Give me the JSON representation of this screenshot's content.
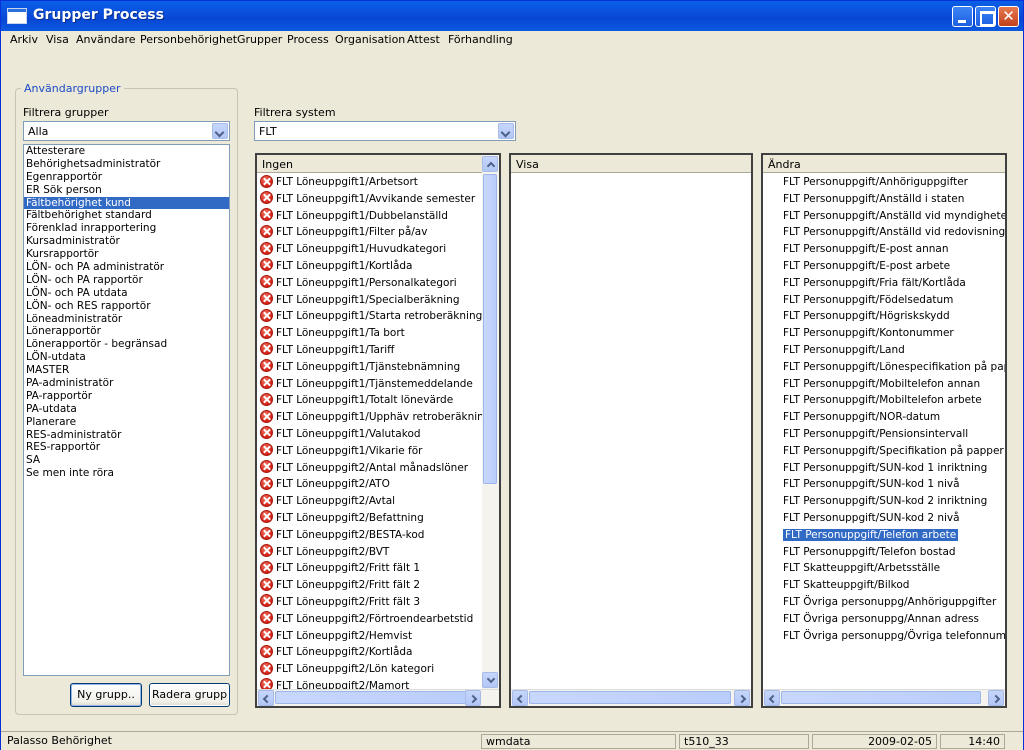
{
  "window": {
    "title": "Grupper Process"
  },
  "menu": [
    "Arkiv",
    "Visa",
    "Användare",
    "Personbehörighet",
    "Grupper",
    "Process",
    "Organisation",
    "Attest",
    "Förhandling"
  ],
  "groups_panel": {
    "title": "Användargrupper",
    "filter_label": "Filtrera grupper",
    "filter_value": "Alla",
    "items": [
      "Attesterare",
      "Behörighetsadministratör",
      "Egenrapportör",
      "ER Sök person",
      "Fältbehörighet kund",
      "Fältbehörighet standard",
      "Förenklad inrapportering",
      "Kursadministratör",
      "Kursrapportör",
      "LÖN- och PA administratör",
      "LÖN- och PA rapportör",
      "LÖN- och PA utdata",
      "LÖN- och RES rapportör",
      "Löneadministratör",
      "Lönerapportör",
      "Lönerapportör - begränsad",
      "LÖN-utdata",
      "MASTER",
      "PA-administratör",
      "PA-rapportör",
      "PA-utdata",
      "Planerare",
      "RES-administratör",
      "RES-rapportör",
      "SA",
      "Se men inte röra"
    ],
    "selected_index": 4,
    "new_button": "Ny grupp..",
    "delete_button": "Radera grupp"
  },
  "system_filter": {
    "label": "Filtrera system",
    "value": "FLT"
  },
  "ingen": {
    "header": "Ingen",
    "items": [
      "FLT Löneuppgift1/Arbetsort",
      "FLT Löneuppgift1/Avvikande semester",
      "FLT Löneuppgift1/Dubbelanställd",
      "FLT Löneuppgift1/Filter på/av",
      "FLT Löneuppgift1/Huvudkategori",
      "FLT Löneuppgift1/Kortlåda",
      "FLT Löneuppgift1/Personalkategori",
      "FLT Löneuppgift1/Specialberäkning",
      "FLT Löneuppgift1/Starta retroberäkning",
      "FLT Löneuppgift1/Ta bort",
      "FLT Löneuppgift1/Tariff",
      "FLT Löneuppgift1/Tjänstebnämning",
      "FLT Löneuppgift1/Tjänstemeddelande",
      "FLT Löneuppgift1/Totalt lönevärde",
      "FLT Löneuppgift1/Upphäv retroberäkning",
      "FLT Löneuppgift1/Valutakod",
      "FLT Löneuppgift1/Vikarie för",
      "FLT Löneuppgift2/Antal månadslöner",
      "FLT Löneuppgift2/ATO",
      "FLT Löneuppgift2/Avtal",
      "FLT Löneuppgift2/Befattning",
      "FLT Löneuppgift2/BESTA-kod",
      "FLT Löneuppgift2/BVT",
      "FLT Löneuppgift2/Fritt fält 1",
      "FLT Löneuppgift2/Fritt fält 2",
      "FLT Löneuppgift2/Fritt fält 3",
      "FLT Löneuppgift2/Förtroendearbetstid",
      "FLT Löneuppgift2/Hemvist",
      "FLT Löneuppgift2/Kortlåda",
      "FLT Löneuppgift2/Lön kategori",
      "FLT Löneuppgift2/Mamort"
    ]
  },
  "visa": {
    "header": "Visa",
    "items": []
  },
  "andra": {
    "header": "Ändra",
    "items": [
      "FLT Personuppgift/Anhöriguppgifter",
      "FLT Personuppgift/Anställd i staten",
      "FLT Personuppgift/Anställd vid myndigheten",
      "FLT Personuppgift/Anställd vid redovisningsen.",
      "FLT Personuppgift/E-post annan",
      "FLT Personuppgift/E-post arbete",
      "FLT Personuppgift/Fria fält/Kortlåda",
      "FLT Personuppgift/Födelsedatum",
      "FLT Personuppgift/Högriskskydd",
      "FLT Personuppgift/Kontonummer",
      "FLT Personuppgift/Land",
      "FLT Personuppgift/Lönespecifikation på pappe",
      "FLT Personuppgift/Mobiltelefon annan",
      "FLT Personuppgift/Mobiltelefon arbete",
      "FLT Personuppgift/NOR-datum",
      "FLT Personuppgift/Pensionsintervall",
      "FLT Personuppgift/Specifikation på papper",
      "FLT Personuppgift/SUN-kod 1 inriktning",
      "FLT Personuppgift/SUN-kod 1 nivå",
      "FLT Personuppgift/SUN-kod 2 inriktning",
      "FLT Personuppgift/SUN-kod 2 nivå",
      "FLT Personuppgift/Telefon arbete",
      "FLT Personuppgift/Telefon bostad",
      "FLT Skatteuppgift/Arbetsställe",
      "FLT Skatteuppgift/Bilkod",
      "FLT Övriga personuppg/Anhöriguppgifter",
      "FLT Övriga personuppg/Annan adress",
      "FLT Övriga personuppg/Övriga telefonnummer"
    ],
    "selected_index": 21
  },
  "status": {
    "app": "Palasso Behörighet",
    "server": "wmdata",
    "db": "t510_33",
    "date": "2009-02-05",
    "time": "14:40"
  }
}
